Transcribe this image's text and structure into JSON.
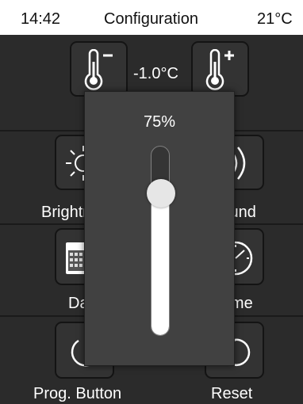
{
  "status_bar": {
    "time": "14:42",
    "title": "Configuration",
    "temperature": "21°C"
  },
  "setpoint": {
    "value": "-1.0°C",
    "decrease_icon": "thermometer-minus-icon",
    "increase_icon": "thermometer-plus-icon"
  },
  "menu": {
    "brightness_label": "Brightness",
    "sound_label": "Sound",
    "date_label": "Date",
    "time_label": "Time",
    "prog_button_label": "Prog. Button",
    "reset_label": "Reset"
  },
  "brightness_popup": {
    "value_text": "75%",
    "level": 0.75
  },
  "colors": {
    "background": "#2b2b2b",
    "status_bar": "#ffffff",
    "popup": "#414141",
    "slider_fill": "#ffffff"
  }
}
